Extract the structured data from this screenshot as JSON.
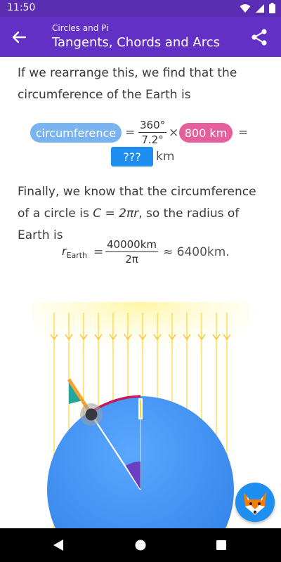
{
  "status": {
    "time": "11:50"
  },
  "header": {
    "subtitle": "Circles and Pi",
    "title": "Tangents, Chords and Arcs"
  },
  "body": {
    "para1": "If we rearrange this, we find that the circumference of the Earth is",
    "eq1": {
      "circumference": "circumference",
      "equals": "=",
      "frac_num": "360°",
      "frac_den": "7.2°",
      "times": "×",
      "distance": "800 km",
      "equals2": "=",
      "answer": "???",
      "unit": "km"
    },
    "para2_a": "Finally, we know that the circumference of a circle is ",
    "para2_formula": "C = 2πr",
    "para2_b": ", so the radius of Earth is",
    "eq2": {
      "r": "r",
      "r_sub": "Earth",
      "equals": "=",
      "frac_num": "40000km",
      "frac_den": "2π",
      "approx": "≈ 6400km."
    }
  },
  "colors": {
    "header": "#6230c5",
    "status": "#5b2db3",
    "circumference_pill": "#7ab4f0",
    "distance_pill": "#e45f9c",
    "answer_box": "#1f8ef1",
    "earth": "#3d8ff0",
    "sun_rays": "#fff176",
    "arc": "#c2185b",
    "angle": "#6a3fc4",
    "shadow": "#26a69a",
    "pole": "#f4a234"
  },
  "icons": {
    "back": "arrow-left-icon",
    "share": "share-icon",
    "mascot": "fox-icon",
    "nav_back": "triangle-back-icon",
    "nav_home": "circle-home-icon",
    "nav_recent": "square-recent-icon"
  }
}
